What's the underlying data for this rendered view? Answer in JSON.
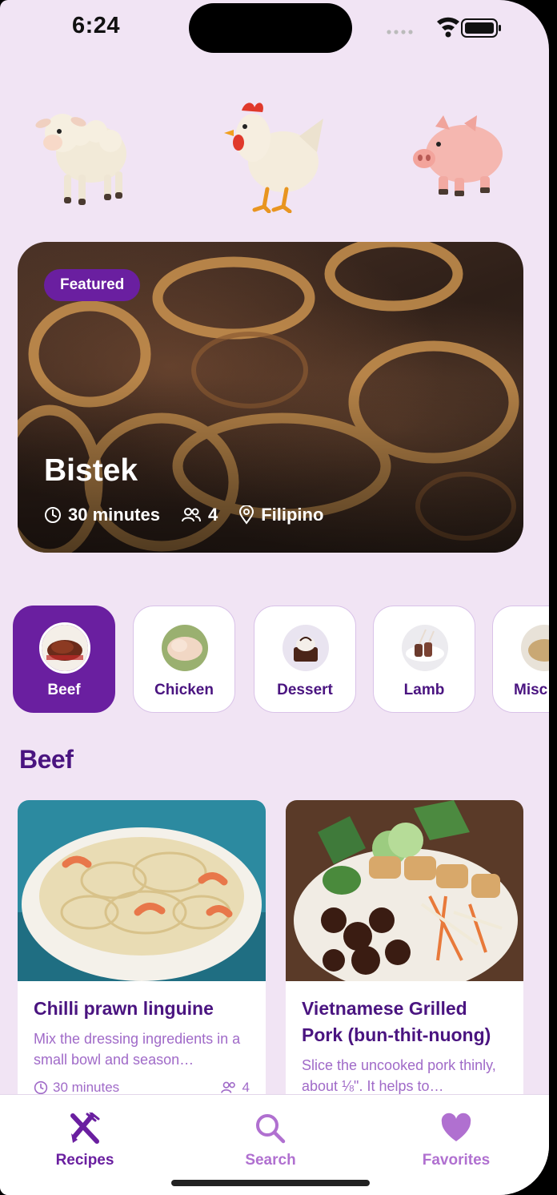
{
  "status_bar": {
    "time": "6:24"
  },
  "animals": [
    {
      "name": "lamb",
      "icon": "lamb-icon"
    },
    {
      "name": "chicken",
      "icon": "chicken-icon"
    },
    {
      "name": "pig",
      "icon": "pig-icon"
    }
  ],
  "featured": {
    "badge": "Featured",
    "title": "Bistek",
    "time": "30 minutes",
    "servings": "4",
    "cuisine": "Filipino"
  },
  "categories": [
    {
      "label": "Beef",
      "active": true
    },
    {
      "label": "Chicken",
      "active": false
    },
    {
      "label": "Dessert",
      "active": false
    },
    {
      "label": "Lamb",
      "active": false
    },
    {
      "label": "Misc",
      "active": false
    }
  ],
  "section": {
    "title": "Beef"
  },
  "recipes": [
    {
      "title": "Chilli prawn linguine",
      "description": "Mix the dressing ingredients in a small bowl and season…",
      "time": "30 minutes",
      "servings": "4"
    },
    {
      "title": "Vietnamese Grilled Pork (bun-thit-nuong)",
      "description": "Slice the uncooked pork thinly, about ⅛\". It helps to…"
    }
  ],
  "tabs": [
    {
      "label": "Recipes",
      "icon": "fork-knife-icon",
      "active": true
    },
    {
      "label": "Search",
      "icon": "search-icon",
      "active": false
    },
    {
      "label": "Favorites",
      "icon": "heart-icon",
      "active": false
    }
  ],
  "colors": {
    "background": "#f1e4f4",
    "accent": "#6a1fa0",
    "title": "#4a1480",
    "muted": "#a06ac8"
  }
}
